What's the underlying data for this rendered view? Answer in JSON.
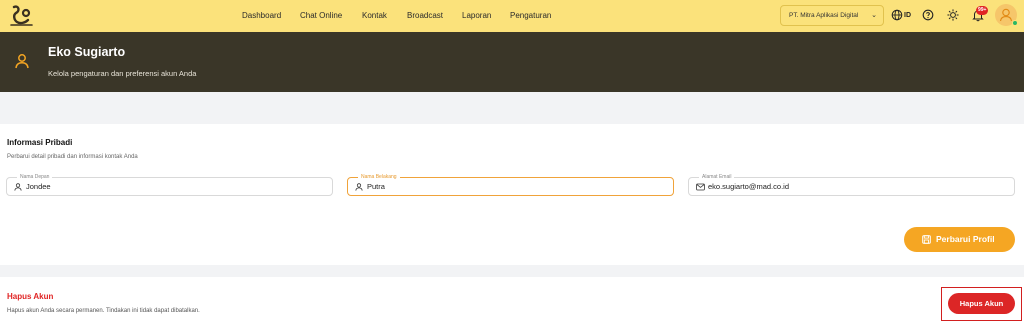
{
  "nav": {
    "items": [
      {
        "label": "Dashboard"
      },
      {
        "label": "Chat Online"
      },
      {
        "label": "Kontak"
      },
      {
        "label": "Broadcast"
      },
      {
        "label": "Laporan"
      },
      {
        "label": "Pengaturan"
      }
    ],
    "company": "PT. Mitra Aplikasi Digital",
    "language": "ID",
    "notification_badge": "99+"
  },
  "header": {
    "title": "Eko Sugiarto",
    "subtitle": "Kelola pengaturan dan preferensi akun Anda"
  },
  "personal_info": {
    "title": "Informasi Pribadi",
    "description": "Perbarui detail pribadi dan informasi kontak Anda",
    "fields": [
      {
        "label": "Nama Depan",
        "value": "Jondee",
        "icon": "user-icon"
      },
      {
        "label": "Nama Belakang",
        "value": "Putra",
        "icon": "user-icon"
      },
      {
        "label": "Alamat Email",
        "value": "eko.sugiarto@mad.co.id",
        "icon": "mail-icon"
      }
    ],
    "save_label": "Perbarui Profil"
  },
  "delete_account": {
    "title": "Hapus Akun",
    "description": "Hapus akun Anda secara permanen. Tindakan ini tidak dapat dibatalkan.",
    "button_label": "Hapus Akun"
  },
  "colors": {
    "topbar": "#fbe27b",
    "header": "#3a3628",
    "accent": "#f5a623",
    "danger": "#dc2626"
  }
}
